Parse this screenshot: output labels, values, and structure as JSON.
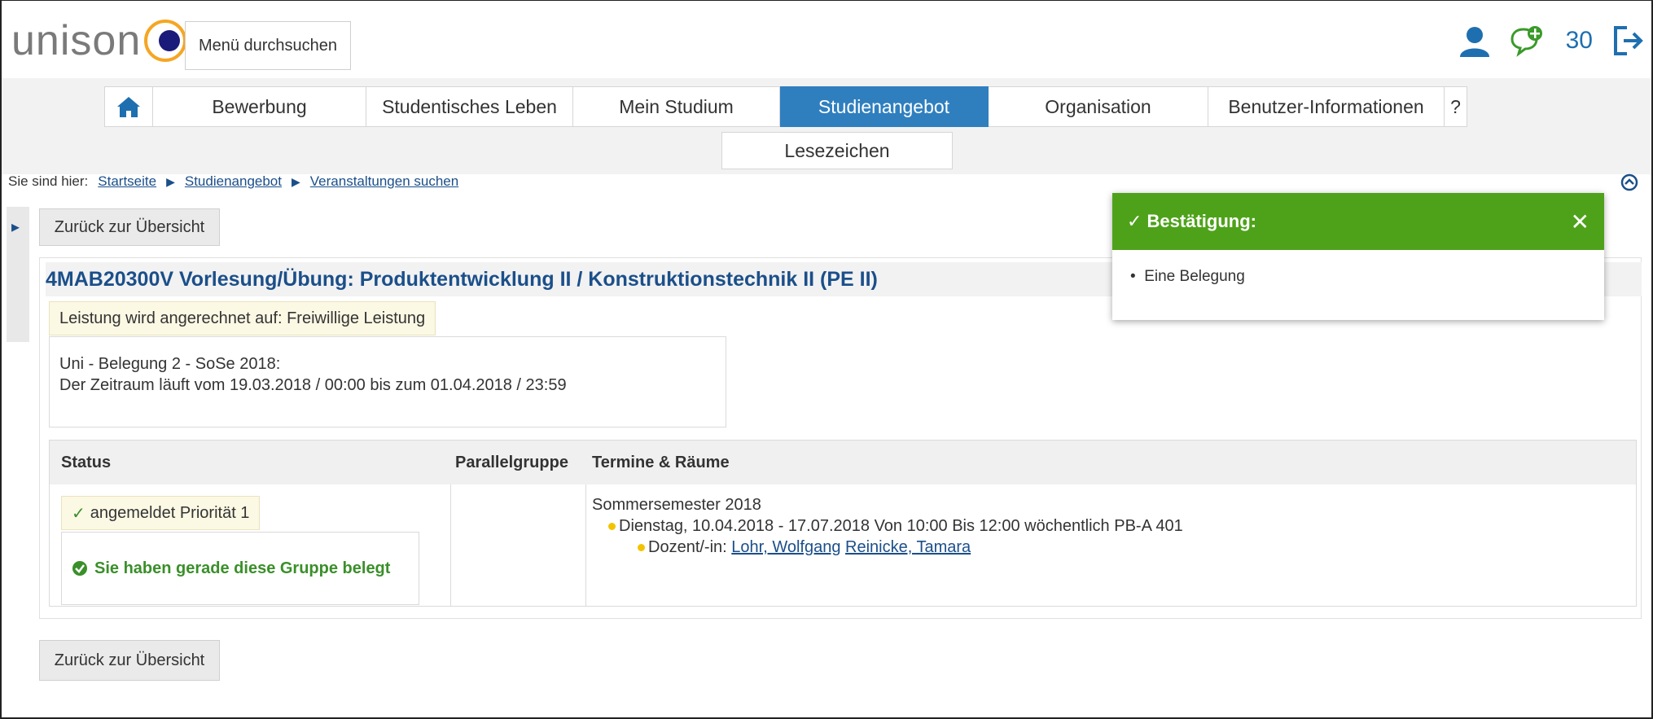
{
  "header": {
    "logo_text": "unison",
    "menu_search_label": "Menü durchsuchen",
    "notification_count": "30"
  },
  "nav": {
    "items": [
      {
        "label": "Bewerbung"
      },
      {
        "label": "Studentisches Leben"
      },
      {
        "label": "Mein Studium"
      },
      {
        "label": "Studienangebot",
        "active": true
      },
      {
        "label": "Organisation"
      },
      {
        "label": "Benutzer-Informationen"
      },
      {
        "label": "?"
      }
    ],
    "subnav_label": "Lesezeichen"
  },
  "breadcrumb": {
    "prefix": "Sie sind hier:",
    "items": [
      "Startseite",
      "Studienangebot",
      "Veranstaltungen suchen"
    ]
  },
  "buttons": {
    "back_label": "Zurück zur Übersicht"
  },
  "course": {
    "title": "4MAB20300V Vorlesung/Übung: Produktentwicklung II / Konstruktionstechnik II (PE II)",
    "leistung": "Leistung wird angerechnet auf: Freiwillige Leistung",
    "period_line1": "Uni - Belegung 2 - SoSe 2018:",
    "period_line2": "Der Zeitraum läuft vom 19.03.2018 / 00:00 bis zum 01.04.2018 / 23:59"
  },
  "table": {
    "headers": {
      "status": "Status",
      "parallel": "Parallelgruppe",
      "termine": "Termine & Räume"
    },
    "status_label": "angemeldet Priorität 1",
    "belegt_message": "Sie haben gerade diese Gruppe belegt",
    "semester": "Sommersemester 2018",
    "termin": "Dienstag, 10.04.2018 - 17.07.2018 Von 10:00 Bis 12:00 wöchentlich PB-A 401",
    "dozent_label": "Dozent/-in:",
    "dozent_1": "Lohr, Wolfgang",
    "dozent_2": "Reinicke, Tamara"
  },
  "toast": {
    "title": "Bestätigung:",
    "message": "Eine Belegung"
  },
  "colors": {
    "accent": "#2f7fbf",
    "link": "#1b4f8a",
    "success": "#4ea21a",
    "logo_dot": "#1a1a7a",
    "logo_ring": "#f5a623"
  }
}
